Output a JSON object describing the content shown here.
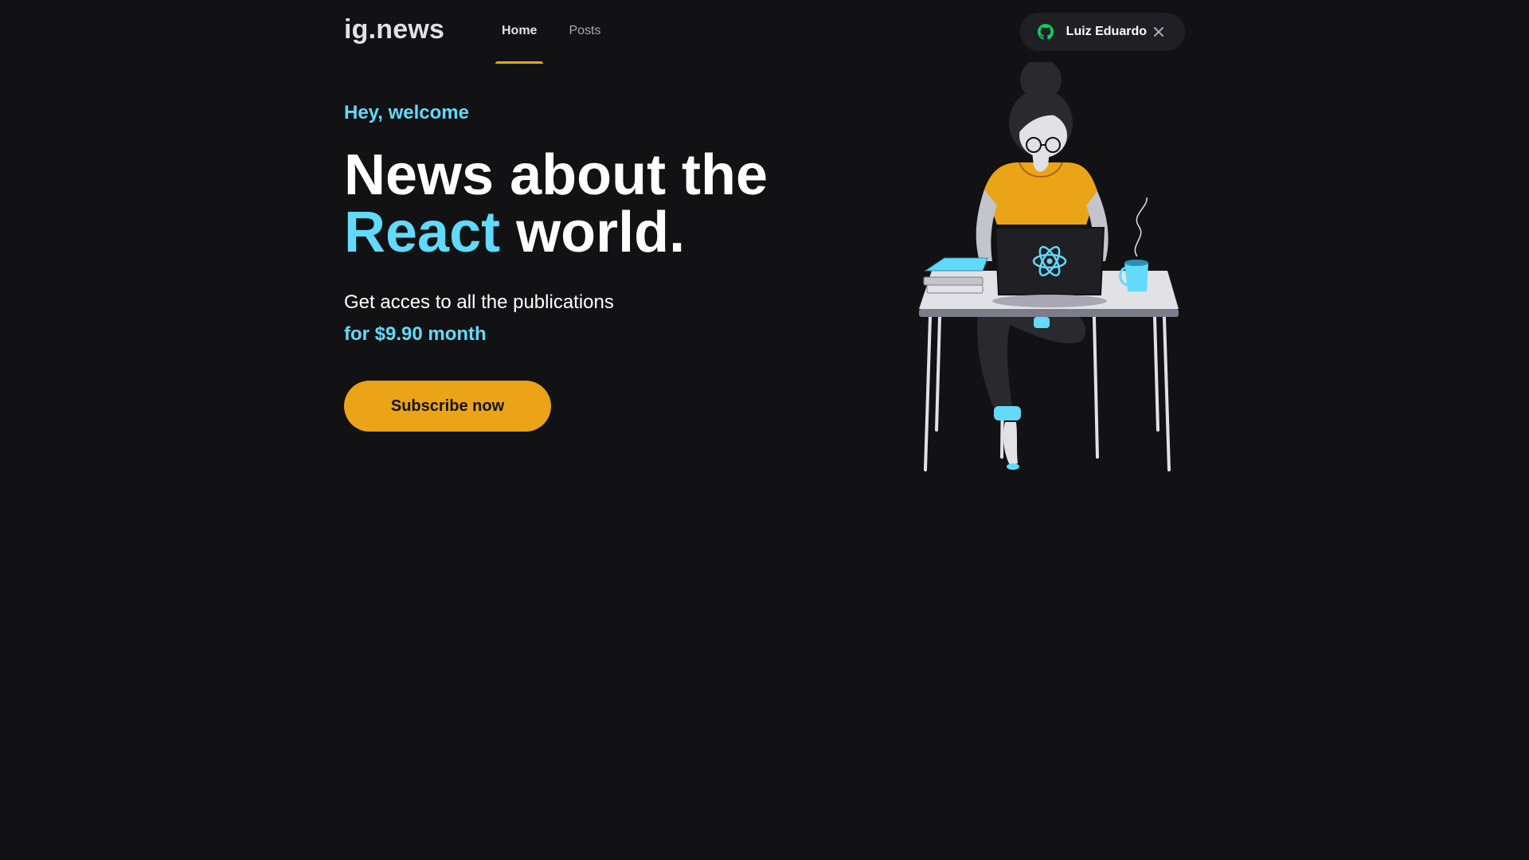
{
  "header": {
    "logo": "ig.news",
    "nav": [
      {
        "label": "Home",
        "active": true
      },
      {
        "label": "Posts",
        "active": false
      }
    ],
    "user": {
      "name": "Luiz Eduardo",
      "icon": "github-icon",
      "icon_color": "#04d361",
      "close_icon": "close-icon"
    }
  },
  "hero": {
    "welcome": "Hey, welcome",
    "headline_part1": "News about the",
    "headline_accent": "React",
    "headline_part2": "world.",
    "subtitle": "Get acces to all the publications",
    "price": "for $9.90 month",
    "cta": "Subscribe now"
  },
  "colors": {
    "background": "#121214",
    "accent_blue": "#61dafb",
    "accent_yellow": "#eba417",
    "button_dark": "#202024"
  }
}
